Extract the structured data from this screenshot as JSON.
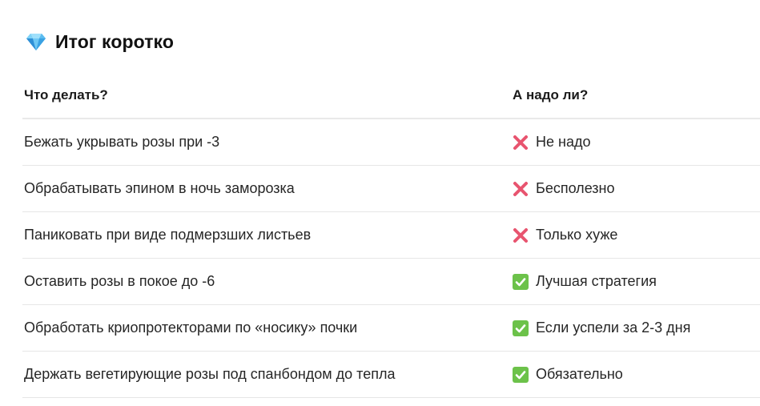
{
  "section": {
    "icon": "gem-icon",
    "title": "Итог коротко"
  },
  "table": {
    "headers": {
      "action": "Что делать?",
      "verdict": "А надо ли?"
    },
    "rows": [
      {
        "action": "Бежать укрывать розы при -3",
        "verdict_icon": "cross-mark-icon",
        "verdict": "Не надо"
      },
      {
        "action": "Обрабатывать эпином в ночь заморозка",
        "verdict_icon": "cross-mark-icon",
        "verdict": "Бесполезно"
      },
      {
        "action": "Паниковать при виде подмерзших листьев",
        "verdict_icon": "cross-mark-icon",
        "verdict": "Только хуже"
      },
      {
        "action": "Оставить розы в покое до -6",
        "verdict_icon": "check-mark-icon",
        "verdict": "Лучшая стратегия"
      },
      {
        "action": "Обработать криопротекторами по «носику» почки",
        "verdict_icon": "check-mark-icon",
        "verdict": "Если успели за 2-3 дня"
      },
      {
        "action": "Держать вегетирующие розы под спанбондом до тепла",
        "verdict_icon": "check-mark-icon",
        "verdict": "Обязательно"
      }
    ]
  },
  "colors": {
    "cross": "#e8546f",
    "check_bg": "#6cc24a",
    "gem_light": "#7fd3f7",
    "gem_dark": "#2f8fd6"
  }
}
